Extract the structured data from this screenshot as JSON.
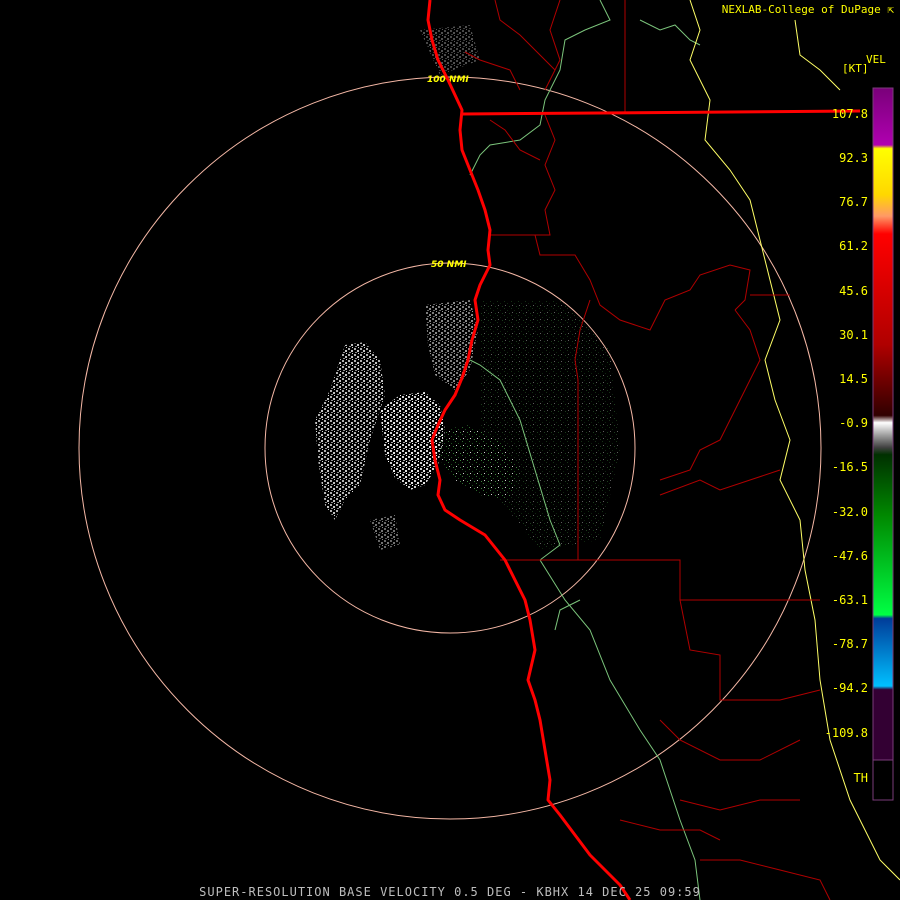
{
  "credit": "NEXLAB-College of DuPage",
  "credit_icon": "cursor-arrow-icon",
  "legend": {
    "product": "VEL",
    "unit": "[KT]",
    "ticks": [
      "107.8",
      "92.3",
      "76.7",
      "61.2",
      "45.6",
      "30.1",
      "14.5",
      "-0.9",
      "-16.5",
      "-32.0",
      "-47.6",
      "-63.1",
      "-78.7",
      "-94.2",
      "-109.8",
      "TH"
    ],
    "colors": {
      "purple": "#800080",
      "yellow": "#ffff00",
      "orange": "#ff9966",
      "red": "#ff0000",
      "dark_red": "#400000",
      "gray": "#ffffff",
      "green": "#00ff00",
      "dark_green": "#004000",
      "blue": "#00bfff",
      "range_fold": "#330033"
    }
  },
  "rings": {
    "inner_label": "50 NMI",
    "outer_label": "100 NMI",
    "color": "#f5b8a6"
  },
  "map_colors": {
    "coastline": "#ff0000",
    "county_lines": "#b00000",
    "rivers": "#7bc47b",
    "state_border": "#ffff66"
  },
  "footer": "SUPER-RESOLUTION BASE VELOCITY 0.5 DEG - KBHX 14 DEC 25 09:59"
}
